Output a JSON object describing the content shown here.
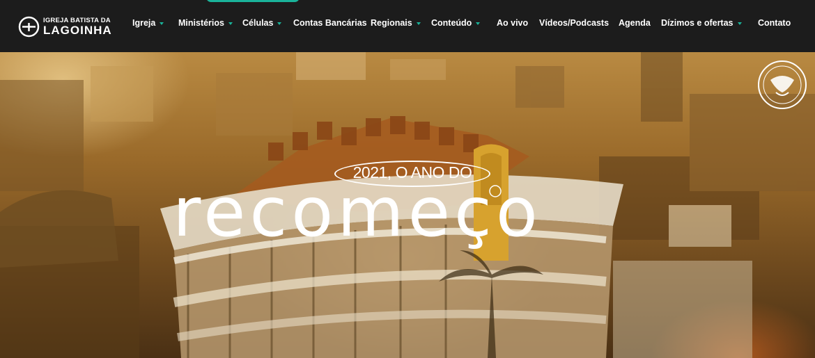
{
  "logo": {
    "line1": "IGREJA BATISTA DA",
    "line2": "LAGOINHA"
  },
  "nav": [
    {
      "label": "Igreja",
      "dropdown": true
    },
    {
      "label": "Ministérios",
      "dropdown": true
    },
    {
      "label": "Células",
      "dropdown": true
    },
    {
      "label": "Contas Bancárias",
      "dropdown": false
    },
    {
      "label": "Regionais",
      "dropdown": true
    },
    {
      "label": "Conteúdo",
      "dropdown": true
    },
    {
      "label": "Ao vivo",
      "dropdown": false
    },
    {
      "label": "Vídeos/Podcasts",
      "dropdown": false
    },
    {
      "label": "Agenda",
      "dropdown": false
    },
    {
      "label": "Dízimos e ofertas",
      "dropdown": true
    },
    {
      "label": "Contato",
      "dropdown": false
    }
  ],
  "hero": {
    "tagline": "2021, O ANO DO",
    "headline": "recomeço"
  },
  "colors": {
    "accent": "#1ab39a",
    "topbar": "#1c1c1c"
  },
  "icons": {
    "logo": "cross-circle-icon",
    "badge": "anniversary-seal-icon",
    "caret": "caret-down-icon"
  }
}
